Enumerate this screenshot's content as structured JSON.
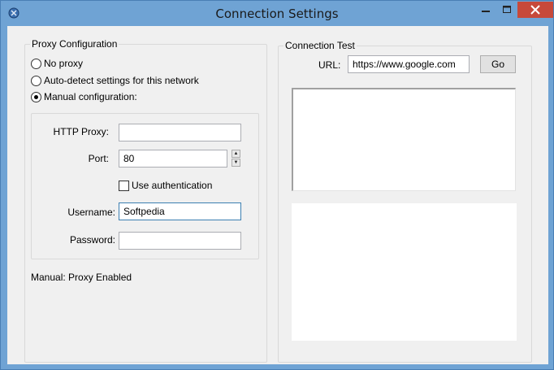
{
  "window": {
    "title": "Connection Settings",
    "icons": {
      "app": "app-icon",
      "minimize": "minimize-icon",
      "maximize": "maximize-icon",
      "close": "close-icon"
    },
    "colors": {
      "frame": "#6fa3d4",
      "close": "#c7493a",
      "client": "#f0f0f0"
    }
  },
  "proxy": {
    "group_title": "Proxy Configuration",
    "options": [
      {
        "label": "No proxy",
        "checked": false
      },
      {
        "label": "Auto-detect settings for this network",
        "checked": false
      },
      {
        "label": "Manual configuration:",
        "checked": true
      }
    ],
    "http_proxy_label": "HTTP Proxy:",
    "http_proxy_value": "",
    "port_label": "Port:",
    "port_value": "80",
    "use_auth_label": "Use authentication",
    "use_auth_checked": false,
    "username_label": "Username:",
    "username_value": "Softpedia",
    "password_label": "Password:",
    "password_value": "",
    "status": "Manual: Proxy Enabled"
  },
  "test": {
    "group_title": "Connection Test",
    "url_label": "URL:",
    "url_value": "https://www.google.com",
    "go_label": "Go",
    "result_text": ""
  }
}
